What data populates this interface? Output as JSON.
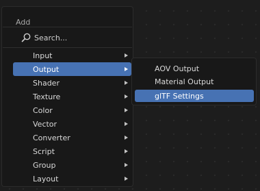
{
  "menu": {
    "title": "Add",
    "search_placeholder": "Search...",
    "items": [
      {
        "label": "Input",
        "has_submenu": true
      },
      {
        "label": "Output",
        "has_submenu": true,
        "active": true
      },
      {
        "label": "Shader",
        "has_submenu": true
      },
      {
        "label": "Texture",
        "has_submenu": true
      },
      {
        "label": "Color",
        "has_submenu": true
      },
      {
        "label": "Vector",
        "has_submenu": true
      },
      {
        "label": "Converter",
        "has_submenu": true
      },
      {
        "label": "Script",
        "has_submenu": true
      },
      {
        "label": "Group",
        "has_submenu": true
      },
      {
        "label": "Layout",
        "has_submenu": true
      }
    ]
  },
  "submenu": {
    "items": [
      {
        "label": "AOV Output"
      },
      {
        "label": "Material Output"
      },
      {
        "label": "glTF Settings",
        "active": true
      }
    ]
  },
  "colors": {
    "highlight": "#4772b3",
    "menu_bg": "#181818",
    "canvas_bg": "#1d1d1d"
  },
  "icons": {
    "search": "search-icon",
    "submenu_arrow": "chevron-right-icon"
  }
}
